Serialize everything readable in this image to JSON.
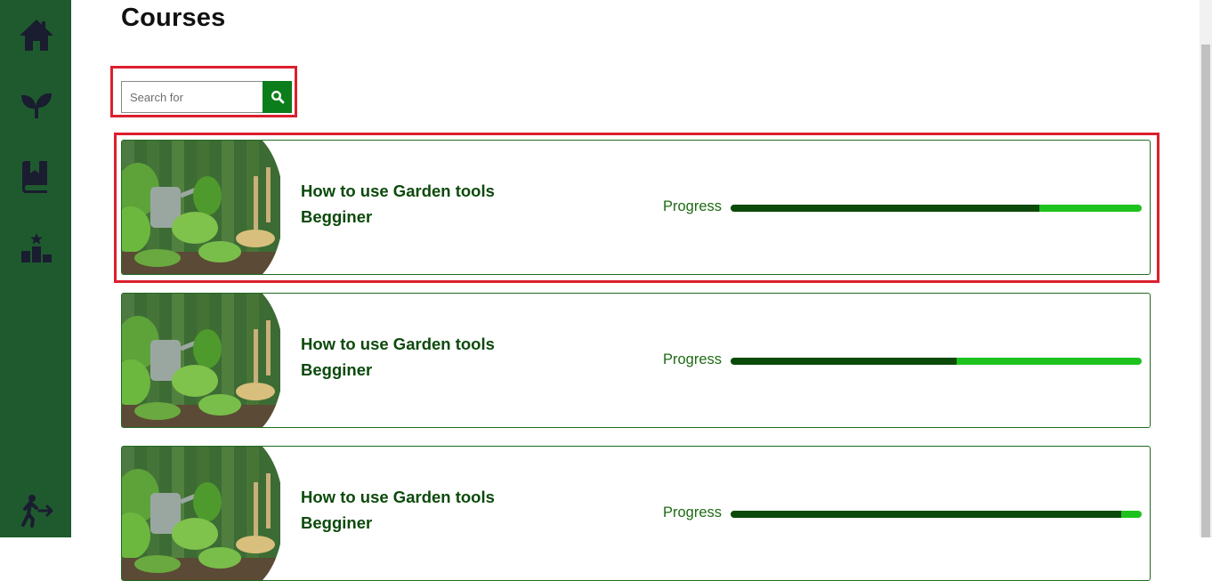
{
  "nav": {
    "items": [
      {
        "name": "home-icon"
      },
      {
        "name": "sprout-icon"
      },
      {
        "name": "bookmark-book-icon"
      },
      {
        "name": "podium-icon"
      },
      {
        "name": "logout-icon"
      }
    ]
  },
  "page": {
    "title": "Courses"
  },
  "search": {
    "placeholder": "Search for",
    "value": "",
    "icon": "search-icon"
  },
  "courses": [
    {
      "title_line1": "How to use Garden tools",
      "title_line2": "Begginer",
      "progress_label": "Progress",
      "progress": 0.75,
      "thumbnail": "garden-tools-image"
    },
    {
      "title_line1": "How to use Garden tools",
      "title_line2": "Begginer",
      "progress_label": "Progress",
      "progress": 0.55,
      "thumbnail": "garden-tools-image"
    },
    {
      "title_line1": "How to use Garden tools",
      "title_line2": "Begginer",
      "progress_label": "Progress",
      "progress": 0.95,
      "thumbnail": "garden-tools-image"
    }
  ],
  "colors": {
    "sidebar": "#1f5a2e",
    "icon": "#1a1c30",
    "accent": "#0b7d1a",
    "title_text": "#0c4a0c",
    "progress_fill": "#0b4a0b",
    "progress_track": "#1ec21e",
    "highlight": "#dc1f2e"
  }
}
